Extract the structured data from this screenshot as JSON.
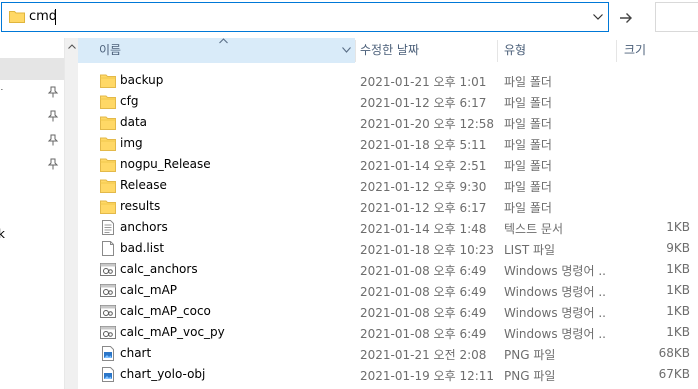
{
  "address_bar": {
    "path": "cmd",
    "folder_icon": "folder-icon",
    "dropdown_icon": "chevron-down-icon",
    "go_icon": "arrow-right-icon"
  },
  "nav": {
    "fragments": [
      "ּ",
      "k"
    ],
    "pin_icon": "pin-icon"
  },
  "columns": {
    "name": "이름",
    "date": "수정한 날짜",
    "type": "유형",
    "size": "크기"
  },
  "files": [
    {
      "name": "backup",
      "date": "2021-01-21 오후 1:01",
      "type": "파일 폴더",
      "size": "",
      "icon": "folder-icon"
    },
    {
      "name": "cfg",
      "date": "2021-01-12 오후 6:17",
      "type": "파일 폴더",
      "size": "",
      "icon": "folder-icon"
    },
    {
      "name": "data",
      "date": "2021-01-20 오후 12:58",
      "type": "파일 폴더",
      "size": "",
      "icon": "folder-icon"
    },
    {
      "name": "img",
      "date": "2021-01-18 오후 5:11",
      "type": "파일 폴더",
      "size": "",
      "icon": "folder-icon"
    },
    {
      "name": "nogpu_Release",
      "date": "2021-01-14 오후 2:51",
      "type": "파일 폴더",
      "size": "",
      "icon": "folder-icon"
    },
    {
      "name": "Release",
      "date": "2021-01-12 오후 9:30",
      "type": "파일 폴더",
      "size": "",
      "icon": "folder-icon"
    },
    {
      "name": "results",
      "date": "2021-01-12 오후 6:17",
      "type": "파일 폴더",
      "size": "",
      "icon": "folder-icon"
    },
    {
      "name": "anchors",
      "date": "2021-01-14 오후 1:48",
      "type": "텍스트 문서",
      "size": "1KB",
      "icon": "text-file-icon"
    },
    {
      "name": "bad.list",
      "date": "2021-01-18 오후 10:23",
      "type": "LIST 파일",
      "size": "9KB",
      "icon": "file-icon"
    },
    {
      "name": "calc_anchors",
      "date": "2021-01-08 오후 6:49",
      "type": "Windows 명령어 ...",
      "size": "1KB",
      "icon": "cmd-file-icon"
    },
    {
      "name": "calc_mAP",
      "date": "2021-01-08 오후 6:49",
      "type": "Windows 명령어 ...",
      "size": "1KB",
      "icon": "cmd-file-icon"
    },
    {
      "name": "calc_mAP_coco",
      "date": "2021-01-08 오후 6:49",
      "type": "Windows 명령어 ...",
      "size": "1KB",
      "icon": "cmd-file-icon"
    },
    {
      "name": "calc_mAP_voc_py",
      "date": "2021-01-08 오후 6:49",
      "type": "Windows 명령어 ...",
      "size": "1KB",
      "icon": "cmd-file-icon"
    },
    {
      "name": "chart",
      "date": "2021-01-21 오전 2:08",
      "type": "PNG 파일",
      "size": "68KB",
      "icon": "image-file-icon"
    },
    {
      "name": "chart_yolo-obj",
      "date": "2021-01-19 오후 12:11",
      "type": "PNG 파일",
      "size": "67KB",
      "icon": "image-file-icon"
    }
  ],
  "colors": {
    "accent": "#0078d7",
    "header_selected": "#d9ebf9",
    "folder": "#ffd866",
    "meta_text": "#6d6d6d"
  }
}
